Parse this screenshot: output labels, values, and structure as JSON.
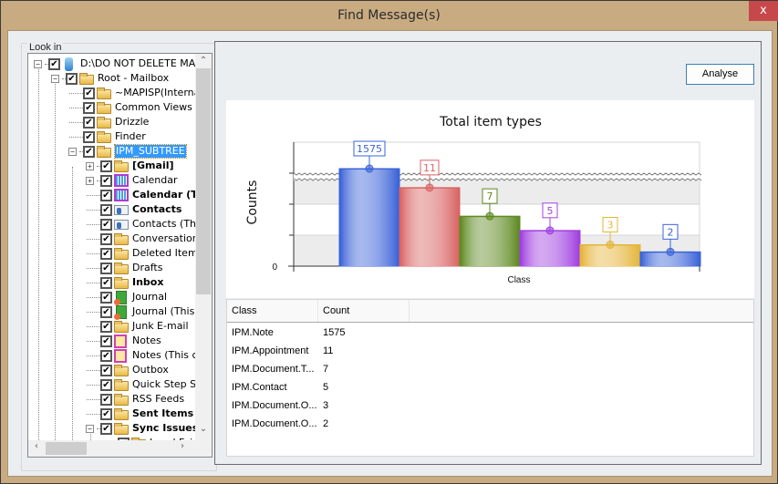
{
  "window": {
    "title": "Find Message(s)",
    "close_glyph": "x"
  },
  "look_in": {
    "label": "Look in",
    "tree": [
      {
        "label": "D:\\DO NOT DELETE MAI",
        "depth": 0,
        "expander": "minus",
        "icon": "database-icon",
        "bold": false,
        "checked": true
      },
      {
        "label": "Root - Mailbox",
        "depth": 1,
        "expander": "minus",
        "icon": "folder-icon",
        "bold": false,
        "checked": true
      },
      {
        "label": "~MAPISP(Interna",
        "depth": 2,
        "expander": "none",
        "icon": "folder-icon",
        "bold": false,
        "checked": true
      },
      {
        "label": "Common Views",
        "depth": 2,
        "expander": "none",
        "icon": "folder-icon",
        "bold": false,
        "checked": true
      },
      {
        "label": "Drizzle",
        "depth": 2,
        "expander": "none",
        "icon": "folder-icon",
        "bold": false,
        "checked": true
      },
      {
        "label": "Finder",
        "depth": 2,
        "expander": "none",
        "icon": "folder-icon",
        "bold": false,
        "checked": true
      },
      {
        "label": "IPM_SUBTREE",
        "depth": 2,
        "expander": "minus",
        "icon": "folder-icon",
        "bold": false,
        "checked": true,
        "selected": true
      },
      {
        "label": "[Gmail]",
        "depth": 3,
        "expander": "plus",
        "icon": "folder-icon",
        "bold": true,
        "checked": true
      },
      {
        "label": "Calendar",
        "depth": 3,
        "expander": "plus",
        "icon": "calendar-icon",
        "bold": false,
        "checked": true
      },
      {
        "label": "Calendar (Th",
        "depth": 3,
        "expander": "none",
        "icon": "calendar-icon",
        "bold": true,
        "checked": true
      },
      {
        "label": "Contacts",
        "depth": 3,
        "expander": "none",
        "icon": "contact-card-icon",
        "bold": true,
        "checked": true
      },
      {
        "label": "Contacts (Th",
        "depth": 3,
        "expander": "none",
        "icon": "contact-card-icon",
        "bold": false,
        "checked": true
      },
      {
        "label": "Conversation",
        "depth": 3,
        "expander": "none",
        "icon": "folder-icon",
        "bold": false,
        "checked": true
      },
      {
        "label": "Deleted Item",
        "depth": 3,
        "expander": "none",
        "icon": "folder-icon",
        "bold": false,
        "checked": true
      },
      {
        "label": "Drafts",
        "depth": 3,
        "expander": "none",
        "icon": "folder-icon",
        "bold": false,
        "checked": true
      },
      {
        "label": "Inbox",
        "depth": 3,
        "expander": "none",
        "icon": "folder-icon",
        "bold": true,
        "checked": true
      },
      {
        "label": "Journal",
        "depth": 3,
        "expander": "none",
        "icon": "journal-icon",
        "bold": false,
        "checked": true
      },
      {
        "label": "Journal (This",
        "depth": 3,
        "expander": "none",
        "icon": "journal-icon",
        "bold": false,
        "checked": true
      },
      {
        "label": "Junk E-mail",
        "depth": 3,
        "expander": "none",
        "icon": "folder-icon",
        "bold": false,
        "checked": true
      },
      {
        "label": "Notes",
        "depth": 3,
        "expander": "none",
        "icon": "notes-icon",
        "bold": false,
        "checked": true
      },
      {
        "label": "Notes (This c",
        "depth": 3,
        "expander": "none",
        "icon": "notes-icon",
        "bold": false,
        "checked": true
      },
      {
        "label": "Outbox",
        "depth": 3,
        "expander": "none",
        "icon": "folder-icon",
        "bold": false,
        "checked": true
      },
      {
        "label": "Quick Step S",
        "depth": 3,
        "expander": "none",
        "icon": "folder-icon",
        "bold": false,
        "checked": true
      },
      {
        "label": "RSS Feeds",
        "depth": 3,
        "expander": "none",
        "icon": "folder-icon",
        "bold": false,
        "checked": true
      },
      {
        "label": "Sent Items",
        "depth": 3,
        "expander": "none",
        "icon": "folder-icon",
        "bold": true,
        "checked": true
      },
      {
        "label": "Sync Issues (",
        "depth": 3,
        "expander": "minus",
        "icon": "folder-icon",
        "bold": true,
        "checked": true
      },
      {
        "label": "Local Fai",
        "depth": 4,
        "expander": "none",
        "icon": "folder-icon",
        "bold": false,
        "checked": true
      }
    ]
  },
  "toolbar": {
    "analyse_label": "Analyse"
  },
  "chart_data": {
    "type": "bar",
    "title": "Total item types",
    "xlabel": "Class",
    "ylabel": "Counts",
    "y_tick_labels": [
      "0"
    ],
    "broken_axis": true,
    "categories": [
      "IPM.Note",
      "IPM.Appointment",
      "IPM.Document.T...",
      "IPM.Contact",
      "IPM.Document.O...",
      "IPM.Document.O..."
    ],
    "values": [
      1575,
      11,
      7,
      5,
      3,
      2
    ],
    "data_labels": [
      "1575",
      "11",
      "7",
      "5",
      "3",
      "2"
    ],
    "colors": [
      "#3b63d8",
      "#d96464",
      "#5f8a22",
      "#a040e0",
      "#e5b53a",
      "#3b63d8"
    ],
    "grid": true,
    "legend": "none"
  },
  "table": {
    "columns": [
      "Class",
      "Count"
    ],
    "rows": [
      [
        "IPM.Note",
        "1575"
      ],
      [
        "IPM.Appointment",
        "11"
      ],
      [
        "IPM.Document.T...",
        "7"
      ],
      [
        "IPM.Contact",
        "5"
      ],
      [
        "IPM.Document.O...",
        "3"
      ],
      [
        "IPM.Document.O...",
        "2"
      ]
    ]
  }
}
